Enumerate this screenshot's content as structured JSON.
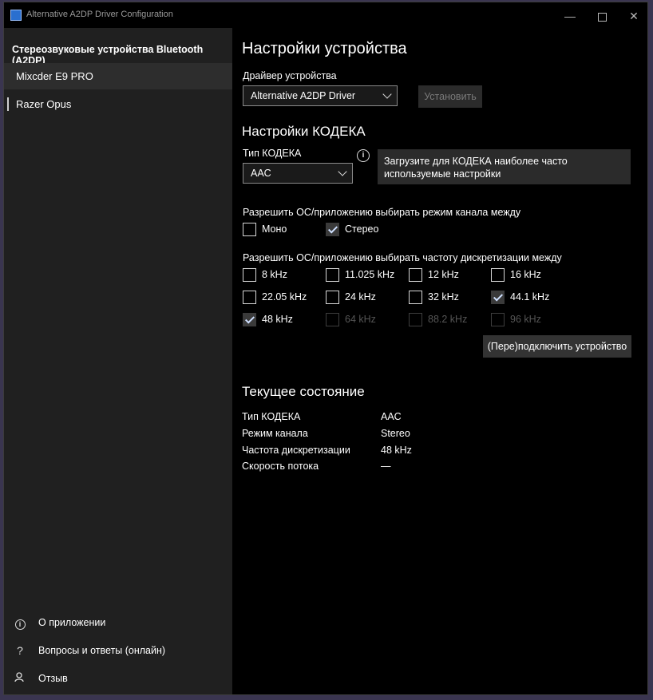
{
  "window": {
    "title": "Alternative A2DP Driver Configuration"
  },
  "sidebar": {
    "header": "Стереозвуковые устройства Bluetooth (A2DP)",
    "items": [
      {
        "label": "Mixcder E9 PRO",
        "selected": true
      },
      {
        "label": "Razer Opus",
        "selected": false
      }
    ],
    "bottom": [
      {
        "label": "О приложении",
        "icon": "info-icon"
      },
      {
        "label": "Вопросы и ответы (онлайн)",
        "icon": "question-icon"
      },
      {
        "label": "Отзыв",
        "icon": "feedback-icon"
      }
    ]
  },
  "main": {
    "title": "Настройки устройства",
    "driver": {
      "label": "Драйвер устройства",
      "value": "Alternative A2DP Driver",
      "install_button": "Установить"
    },
    "codec": {
      "section_title": "Настройки КОДЕКА",
      "type_label": "Тип КОДЕКА",
      "value": "AAC",
      "tooltip": "Загрузите для КОДЕКА наиболее часто используемые настройки"
    },
    "channel": {
      "label": "Разрешить ОС/приложению выбирать режим канала между",
      "options": [
        {
          "label": "Моно",
          "checked": false,
          "disabled": false
        },
        {
          "label": "Стерео",
          "checked": true,
          "disabled": false
        }
      ]
    },
    "sample_rate": {
      "label": "Разрешить ОС/приложению выбирать частоту дискретизации между",
      "options": [
        {
          "label": "8 kHz",
          "checked": false,
          "disabled": false
        },
        {
          "label": "11.025 kHz",
          "checked": false,
          "disabled": false
        },
        {
          "label": "12 kHz",
          "checked": false,
          "disabled": false
        },
        {
          "label": "16 kHz",
          "checked": false,
          "disabled": false
        },
        {
          "label": "22.05 kHz",
          "checked": false,
          "disabled": false
        },
        {
          "label": "24 kHz",
          "checked": false,
          "disabled": false
        },
        {
          "label": "32 kHz",
          "checked": false,
          "disabled": false
        },
        {
          "label": "44.1 kHz",
          "checked": true,
          "disabled": false
        },
        {
          "label": "48 kHz",
          "checked": true,
          "disabled": false
        },
        {
          "label": "64 kHz",
          "checked": false,
          "disabled": true
        },
        {
          "label": "88.2 kHz",
          "checked": false,
          "disabled": true
        },
        {
          "label": "96 kHz",
          "checked": false,
          "disabled": true
        }
      ]
    },
    "reconnect_button": "(Пере)подключить устройство",
    "status": {
      "title": "Текущее состояние",
      "rows": [
        {
          "key": "Тип КОДЕКА",
          "value": "AAC"
        },
        {
          "key": "Режим канала",
          "value": "Stereo"
        },
        {
          "key": "Частота дискретизации",
          "value": "48 kHz"
        },
        {
          "key": "Скорость потока",
          "value": "—"
        }
      ]
    }
  },
  "colors": {
    "window_bg": "#000000",
    "sidebar_bg": "#202020",
    "selected_bg": "#2d2d2d",
    "tooltip_bg": "#2b2b2b"
  }
}
